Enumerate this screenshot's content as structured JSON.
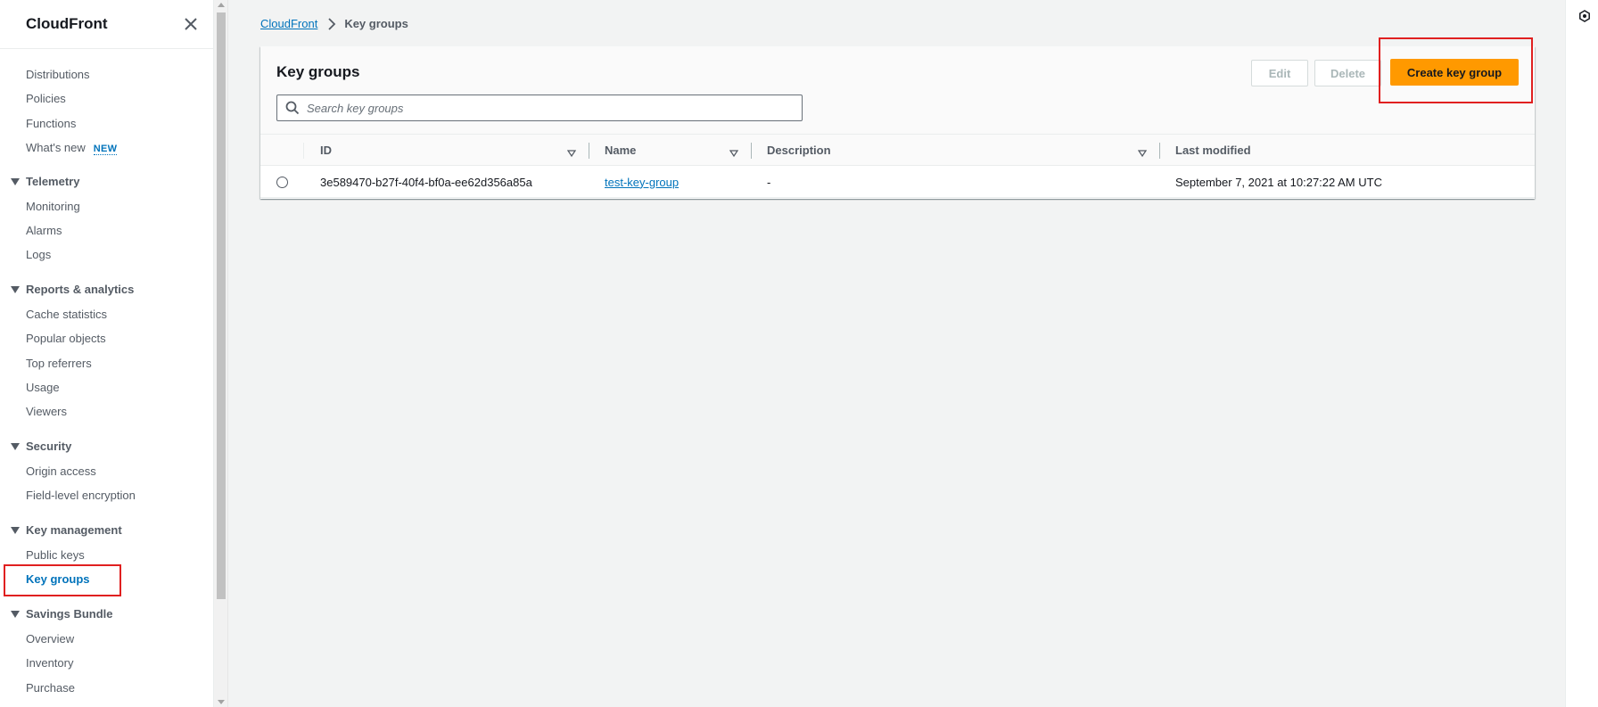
{
  "sidebar": {
    "title": "CloudFront",
    "items_top": [
      {
        "label": "Distributions"
      },
      {
        "label": "Policies"
      },
      {
        "label": "Functions"
      },
      {
        "label": "What's new",
        "badge": "NEW"
      }
    ],
    "sections": [
      {
        "label": "Telemetry",
        "items": [
          "Monitoring",
          "Alarms",
          "Logs"
        ]
      },
      {
        "label": "Reports & analytics",
        "items": [
          "Cache statistics",
          "Popular objects",
          "Top referrers",
          "Usage",
          "Viewers"
        ]
      },
      {
        "label": "Security",
        "items": [
          "Origin access",
          "Field-level encryption"
        ]
      },
      {
        "label": "Key management",
        "items": [
          "Public keys",
          "Key groups"
        ]
      },
      {
        "label": "Savings Bundle",
        "items": [
          "Overview",
          "Inventory",
          "Purchase"
        ]
      }
    ],
    "active_item": "Key groups"
  },
  "breadcrumb": {
    "root": "CloudFront",
    "current": "Key groups"
  },
  "panel": {
    "title": "Key groups",
    "edit_label": "Edit",
    "delete_label": "Delete",
    "create_label": "Create key group",
    "search_placeholder": "Search key groups"
  },
  "table": {
    "columns": [
      "ID",
      "Name",
      "Description",
      "Last modified"
    ],
    "rows": [
      {
        "id": "3e589470-b27f-40f4-bf0a-ee62d356a85a",
        "name": "test-key-group",
        "description": "-",
        "last_modified": "September 7, 2021 at 10:27:22 AM UTC"
      }
    ]
  },
  "colors": {
    "primary_button": "#ff9900",
    "link": "#0073bb",
    "highlight": "#e02020"
  }
}
